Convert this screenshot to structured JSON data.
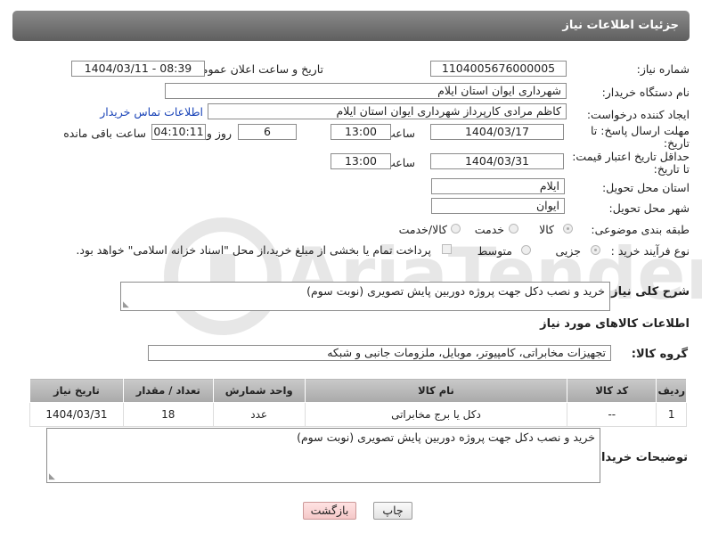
{
  "header": {
    "title": "جزئیات اطلاعات نیاز"
  },
  "fields": {
    "need_number_label": "شماره نیاز:",
    "need_number": "1104005676000005",
    "announce_label": "تاریخ و ساعت اعلان عمومی:",
    "announce_value": "1404/03/11 - 08:39",
    "buyer_org_label": "نام دستگاه خریدار:",
    "buyer_org": "شهرداری ایوان استان ایلام",
    "creator_label": "ایجاد کننده درخواست:",
    "creator": "کاظم مرادی کارپرداز شهرداری ایوان استان ایلام",
    "contact_link": "اطلاعات تماس خریدار",
    "deadline_label_1": "مهلت ارسال پاسخ: تا",
    "deadline_label_2": "تاریخ:",
    "deadline_date": "1404/03/17",
    "time_label": "ساعت",
    "deadline_time": "13:00",
    "days_value": "6",
    "days_label": "روز و",
    "remaining_time": "04:10:11",
    "remaining_label": "ساعت باقی مانده",
    "min_price_label_1": "حداقل تاریخ اعتبار قیمت:",
    "min_price_label_2": "تا تاریخ:",
    "price_date": "1404/03/31",
    "price_time": "13:00",
    "province_label": "استان محل تحویل:",
    "province": "ایلام",
    "city_label": "شهر محل تحویل:",
    "city": "ایوان",
    "category_label": "طبقه بندی موضوعی:",
    "category_options": [
      "کالا",
      "خدمت",
      "کالا/خدمت"
    ],
    "process_label": "نوع فرآیند خرید :",
    "process_options": [
      "جزیی",
      "متوسط"
    ],
    "payment_note": "پرداخت تمام یا بخشی از مبلغ خرید،از محل \"اسناد خزانه اسلامی\" خواهد بود."
  },
  "description": {
    "label": "شرح کلی نیاز:",
    "value": "خرید و نصب دکل جهت پروژه دوربین پایش تصویری (نوبت سوم)"
  },
  "goods": {
    "section_title": "اطلاعات کالاهای مورد نیاز",
    "group_label": "گروه کالا:",
    "group_value": "تجهیزات مخابراتی، کامپیوتر، موبایل، ملزومات جانبی و شبکه",
    "columns": [
      "ردیف",
      "کد کالا",
      "نام کالا",
      "واحد شمارش",
      "تعداد / مقدار",
      "تاریخ نیاز"
    ],
    "rows": [
      [
        "1",
        "--",
        "دکل یا برج مخابراتی",
        "عدد",
        "18",
        "1404/03/31"
      ]
    ]
  },
  "buyer_notes": {
    "label": "توضیحات خریدار:",
    "value": "خرید و نصب دکل جهت پروژه دوربین پایش تصویری (نوبت سوم)"
  },
  "buttons": {
    "print": "چاپ",
    "back": "بازگشت"
  },
  "watermark": {
    "text": "AriaTender.net"
  }
}
